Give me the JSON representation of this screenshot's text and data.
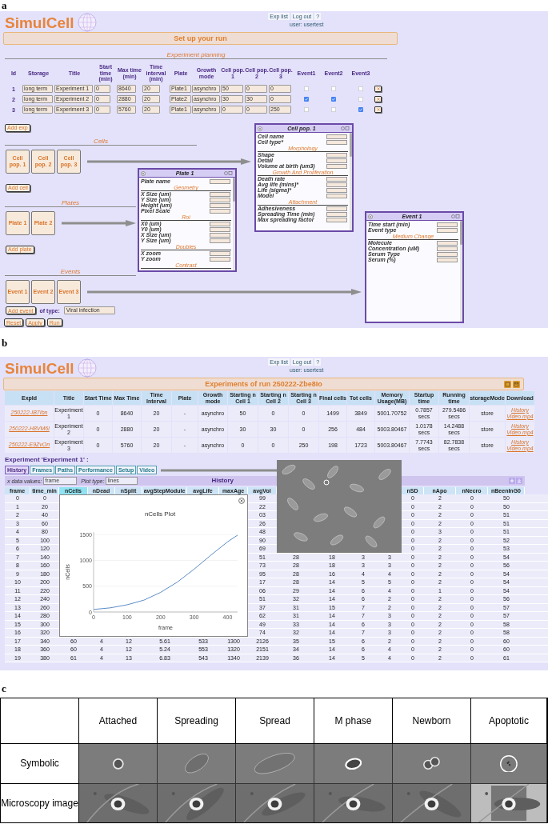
{
  "setup": {
    "panel_label": "a",
    "header": {
      "logo": "SimulCell",
      "nav_links": [
        "Exp list",
        "Log out",
        "?"
      ],
      "user": "user: usertest"
    },
    "banner": "Set up your run",
    "planning_title": "Experiment planning",
    "experiments": {
      "columns": [
        "Id",
        "Storage",
        "Title",
        "Start time (min)",
        "Max time (min)",
        "Time interval (min)",
        "Plate",
        "Growth mode",
        "Cell pop. 1",
        "Cell pop. 2",
        "Cell pop. 3",
        "Event1",
        "Event2",
        "Event3"
      ],
      "rows": [
        {
          "id": "1",
          "storage": "long term",
          "title": "Experiment 1",
          "start_time": "0",
          "max_time": "8640",
          "time_interval": "20",
          "plate": "Plate1",
          "growth_mode": "asynchro",
          "cell_pops": [
            "50",
            "0",
            "0"
          ],
          "events": [
            {
              "checked": false
            },
            {
              "checked": false
            },
            {
              "checked": false
            }
          ]
        },
        {
          "id": "2",
          "storage": "long term",
          "title": "Experiment 2",
          "start_time": "0",
          "max_time": "2880",
          "time_interval": "20",
          "plate": "Plate2",
          "growth_mode": "asynchro",
          "cell_pops": [
            "30",
            "30",
            "0"
          ],
          "events": [
            {
              "checked": true
            },
            {
              "checked": true
            },
            {
              "checked": false
            }
          ]
        },
        {
          "id": "3",
          "storage": "long term",
          "title": "Experiment 3",
          "start_time": "0",
          "max_time": "5760",
          "time_interval": "20",
          "plate": "Plate1",
          "growth_mode": "asynchro",
          "cell_pops": [
            "0",
            "0",
            "250"
          ],
          "events": [
            {
              "checked": false
            },
            {
              "checked": false
            },
            {
              "checked": true
            }
          ]
        }
      ]
    },
    "add_exp_button": "Add exp",
    "cells": {
      "title": "Cells",
      "tiles": [
        "Cell pop. 1",
        "Cell pop. 2",
        "Cell pop. 3"
      ],
      "add_button": "Add cell"
    },
    "plates": {
      "title": "Plates",
      "tiles": [
        "Plate 1",
        "Plate 2"
      ],
      "add_button": "Add plate"
    },
    "events": {
      "title": "Events",
      "tiles": [
        "Event 1",
        "Event 2",
        "Event 3"
      ],
      "add_button": "Add event",
      "type_label": "of type:",
      "type_value": "Viral infection"
    },
    "action_buttons": [
      "Reset",
      "Apply",
      "Run"
    ],
    "windows": [
      {
        "title": "Plate 1",
        "sections": [
          {
            "fields": [
              {
                "label": "Plate name"
              }
            ]
          },
          {
            "heading": "Geometry",
            "fields": [
              {
                "label": "X Size (um)"
              },
              {
                "label": "Y Size (um)"
              },
              {
                "label": "Height (um)"
              },
              {
                "label": "Pixel Scale"
              }
            ]
          },
          {
            "heading": "Roi",
            "fields": [
              {
                "label": "X0 (um)"
              },
              {
                "label": "Y0 (um)"
              },
              {
                "label": "X Size (um)"
              },
              {
                "label": "Y Size (um)"
              }
            ]
          },
          {
            "heading": "Doubles",
            "fields": [
              {
                "label": "X zoom"
              },
              {
                "label": "Y zoom"
              }
            ]
          },
          {
            "heading": "Contrast"
          }
        ]
      },
      {
        "title": "Cell pop. 1",
        "sections": [
          {
            "fields": [
              {
                "label": "Cell name"
              },
              {
                "label": "Cell type*"
              }
            ]
          },
          {
            "heading": "Morphology",
            "fields": [
              {
                "label": "Shape"
              },
              {
                "label": "Detail"
              },
              {
                "label": "Volume at birth (um3)"
              }
            ]
          },
          {
            "heading": "Growth And Proliferation",
            "fields": [
              {
                "label": "Death rate"
              },
              {
                "label": "Avg life (mins)*"
              },
              {
                "label": "Life (sigma)*"
              },
              {
                "label": "Model"
              }
            ]
          },
          {
            "heading": "Attachment",
            "fields": [
              {
                "label": "Adhesiveness"
              },
              {
                "label": "Spreading Time (min)"
              },
              {
                "label": "Max spreading factor"
              }
            ]
          }
        ]
      },
      {
        "title": "Event 1",
        "sections": [
          {
            "fields": [
              {
                "label": "Time start (min)"
              },
              {
                "label": "Event type"
              }
            ]
          },
          {
            "heading": "Medium Change",
            "fields": [
              {
                "label": "Molecule"
              },
              {
                "label": "Concentration (uM)"
              },
              {
                "label": "Serum Type"
              },
              {
                "label": "Serum (%)"
              }
            ]
          }
        ]
      }
    ]
  },
  "results": {
    "panel_label": "b",
    "header": {
      "logo": "SimulCell",
      "nav_links": [
        "Exp list",
        "Log out",
        "?"
      ],
      "user": "user: usertest"
    },
    "banner": "Experiments of run 250222-Zbe8Io",
    "runs": {
      "columns": [
        "ExpId",
        "Title",
        "Start Time",
        "Max Time",
        "Time Interval",
        "Plate",
        "Growth mode",
        "Starting n Cell 1",
        "Starting n Cell 2",
        "Starting n Cell 3",
        "Final cells",
        "Tot cells",
        "Memory Usage(MB)",
        "Startup time",
        "Running time",
        "storageMode",
        "Download"
      ],
      "rows": [
        {
          "cells": [
            "250222-IB7Ibn",
            "Experiment 1",
            "0",
            "8640",
            "20",
            "-",
            "asynchro",
            "50",
            "0",
            "0",
            "1499",
            "3849",
            "5001.70752",
            "0.7857 secs",
            "279.5486 secs",
            "store"
          ],
          "downloads": [
            "History",
            "Video mp4"
          ]
        },
        {
          "cells": [
            "250222-H8VM6l",
            "Experiment 2",
            "0",
            "2880",
            "20",
            "-",
            "asynchro",
            "30",
            "30",
            "0",
            "256",
            "484",
            "5003.80467",
            "1.0178 secs",
            "14.2488 secs",
            "store"
          ],
          "downloads": [
            "History",
            "Video mp4"
          ]
        },
        {
          "cells": [
            "250222-E9ZvOn",
            "Experiment 3",
            "0",
            "5760",
            "20",
            "-",
            "asynchro",
            "0",
            "0",
            "250",
            "198",
            "1723",
            "5003.80467",
            "7.7743 secs",
            "82.7838 secs",
            "store"
          ],
          "downloads": [
            "History",
            "Video mp4"
          ]
        }
      ]
    },
    "experiment_heading": "Experiment 'Experiment 1' :",
    "tabs": [
      {
        "label": "History",
        "selected": true
      },
      {
        "label": "Frames",
        "selected": false
      },
      {
        "label": "Paths",
        "selected": false
      },
      {
        "label": "Performance",
        "selected": false
      },
      {
        "label": "Setup",
        "selected": false
      },
      {
        "label": "Video",
        "selected": false
      }
    ],
    "toolbar": {
      "x_label": "x data values:",
      "x_value": "frame",
      "plot_label": "Plot type:",
      "plot_value": "lines",
      "title": "History"
    },
    "history": {
      "columns": [
        {
          "label": "frame",
          "selected": false
        },
        {
          "label": "time_min",
          "selected": false
        },
        {
          "label": "nCells",
          "selected": true
        },
        {
          "label": "nDead",
          "selected": false
        },
        {
          "label": "nSplit",
          "selected": false
        },
        {
          "label": "avgStepModule",
          "selected": false
        },
        {
          "label": "avgLife",
          "selected": false
        },
        {
          "label": "maxAge",
          "selected": false
        },
        {
          "label": "avgVol",
          "selected": false
        },
        null,
        null,
        null,
        null,
        {
          "label": "nSD",
          "selected": false
        },
        {
          "label": "nApo",
          "selected": false
        },
        {
          "label": "nNecro",
          "selected": false
        },
        {
          "label": "nBeenInG0",
          "selected": false
        }
      ],
      "rows": [
        [
          "0",
          "0",
          null,
          null,
          null,
          null,
          null,
          null,
          "99",
          null,
          null,
          null,
          null,
          "0",
          "2",
          "0",
          "50"
        ],
        [
          "1",
          "20",
          null,
          null,
          null,
          null,
          null,
          null,
          "22",
          null,
          null,
          null,
          null,
          "0",
          "2",
          "0",
          "50"
        ],
        [
          "2",
          "40",
          null,
          null,
          null,
          null,
          null,
          null,
          "03",
          null,
          null,
          null,
          null,
          "0",
          "2",
          "0",
          "51"
        ],
        [
          "3",
          "60",
          null,
          null,
          null,
          null,
          null,
          null,
          "26",
          null,
          null,
          null,
          null,
          "0",
          "2",
          "0",
          "51"
        ],
        [
          "4",
          "80",
          null,
          null,
          null,
          null,
          null,
          null,
          "48",
          null,
          null,
          null,
          null,
          "0",
          "3",
          "0",
          "51"
        ],
        [
          "5",
          "100",
          null,
          null,
          null,
          null,
          null,
          null,
          "90",
          null,
          null,
          null,
          null,
          "0",
          "2",
          "0",
          "52"
        ],
        [
          "6",
          "120",
          null,
          null,
          null,
          null,
          null,
          null,
          "69",
          null,
          null,
          null,
          null,
          "0",
          "2",
          "0",
          "53"
        ],
        [
          "7",
          "140",
          null,
          null,
          null,
          null,
          null,
          null,
          "51",
          "28",
          "18",
          "3",
          "3",
          "0",
          "2",
          "0",
          "54"
        ],
        [
          "8",
          "160",
          null,
          null,
          null,
          null,
          null,
          null,
          "73",
          "28",
          "18",
          "3",
          "3",
          "0",
          "2",
          "0",
          "56"
        ],
        [
          "9",
          "180",
          null,
          null,
          null,
          null,
          null,
          null,
          "95",
          "28",
          "16",
          "4",
          "4",
          "0",
          "2",
          "0",
          "54"
        ],
        [
          "10",
          "200",
          null,
          null,
          null,
          null,
          null,
          null,
          "17",
          "28",
          "14",
          "5",
          "5",
          "0",
          "2",
          "0",
          "54"
        ],
        [
          "11",
          "220",
          null,
          null,
          null,
          null,
          null,
          null,
          "06",
          "29",
          "14",
          "6",
          "4",
          "0",
          "1",
          "0",
          "54"
        ],
        [
          "12",
          "240",
          null,
          null,
          null,
          null,
          null,
          null,
          "51",
          "32",
          "14",
          "6",
          "2",
          "0",
          "2",
          "0",
          "56"
        ],
        [
          "13",
          "260",
          null,
          null,
          null,
          null,
          null,
          null,
          "37",
          "31",
          "15",
          "7",
          "2",
          "0",
          "2",
          "0",
          "57"
        ],
        [
          "14",
          "280",
          null,
          null,
          null,
          null,
          null,
          null,
          "62",
          "31",
          "14",
          "7",
          "3",
          "0",
          "2",
          "0",
          "57"
        ],
        [
          "15",
          "300",
          null,
          null,
          null,
          null,
          null,
          null,
          "49",
          "33",
          "14",
          "6",
          "3",
          "0",
          "2",
          "0",
          "58"
        ],
        [
          "16",
          "320",
          null,
          null,
          null,
          null,
          null,
          null,
          "74",
          "32",
          "14",
          "7",
          "3",
          "0",
          "2",
          "0",
          "58"
        ],
        [
          "17",
          "340",
          "60",
          "4",
          "12",
          "5.61",
          "533",
          "1300",
          "2126",
          "35",
          "15",
          "6",
          "2",
          "0",
          "2",
          "0",
          "60"
        ],
        [
          "18",
          "360",
          "60",
          "4",
          "12",
          "5.24",
          "553",
          "1320",
          "2151",
          "34",
          "14",
          "6",
          "4",
          "0",
          "2",
          "0",
          "60"
        ],
        [
          "19",
          "380",
          "61",
          "4",
          "13",
          "6.83",
          "543",
          "1340",
          "2139",
          "36",
          "14",
          "5",
          "4",
          "0",
          "2",
          "0",
          "61"
        ]
      ]
    },
    "plot": {
      "chart_data": {
        "type": "line",
        "title": "nCells Plot",
        "xlabel": "frame",
        "ylabel": "nCells",
        "x": [
          0,
          50,
          100,
          150,
          200,
          250,
          300,
          350,
          400,
          430
        ],
        "series": [
          {
            "color": "#4a7fc0",
            "values": [
              50,
              80,
              140,
              230,
              380,
              580,
              830,
              1100,
              1360,
              1490
            ]
          }
        ],
        "grid": true,
        "xlim": [
          0,
          430
        ],
        "ylim": [
          0,
          1550
        ],
        "xticks": [
          0,
          100,
          200,
          300,
          400
        ],
        "yticks": [
          0,
          500,
          1000,
          1500
        ]
      }
    }
  },
  "cell_states": {
    "panel_label": "c",
    "columns": [
      "Attached",
      "Spreading",
      "Spread",
      "M phase",
      "Newborn",
      "Apoptotic"
    ],
    "rows": [
      {
        "label": "Symbolic",
        "kind": "symbolic",
        "cells": [
          {
            "kind": "round"
          },
          {
            "kind": "thin-ellipse"
          },
          {
            "kind": "wide-ellipse"
          },
          {
            "kind": "bright-ellipse"
          },
          {
            "kind": "pair"
          },
          {
            "kind": "dotted-circle"
          }
        ]
      },
      {
        "label": "Microscopy image",
        "kind": "microscopy"
      }
    ]
  }
}
